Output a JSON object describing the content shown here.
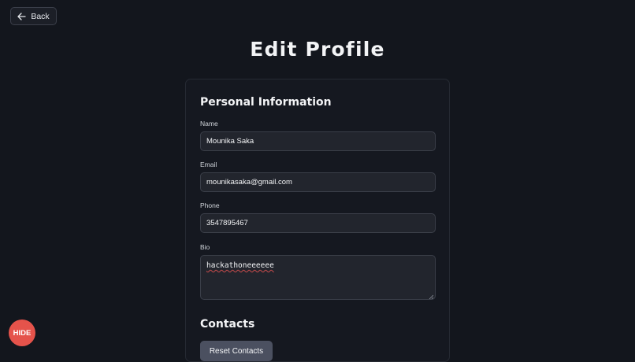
{
  "header": {
    "back_label": "Back",
    "back_icon": "arrow-left-icon",
    "title": "Edit Profile"
  },
  "personal": {
    "section_title": "Personal Information",
    "fields": {
      "name": {
        "label": "Name",
        "value": "Mounika Saka"
      },
      "email": {
        "label": "Email",
        "value": "mounikasaka@gmail.com"
      },
      "phone": {
        "label": "Phone",
        "value": "3547895467"
      },
      "bio": {
        "label": "Bio",
        "value": "hackathoneeeeee"
      }
    }
  },
  "contacts": {
    "section_title": "Contacts",
    "reset_label": "Reset Contacts"
  },
  "floating": {
    "hide_label": "HIDE"
  },
  "colors": {
    "background": "#13161d",
    "card": "#151820",
    "input": "#22252d",
    "reset_button": "#4b5060",
    "hide_button": "#e5534b"
  }
}
